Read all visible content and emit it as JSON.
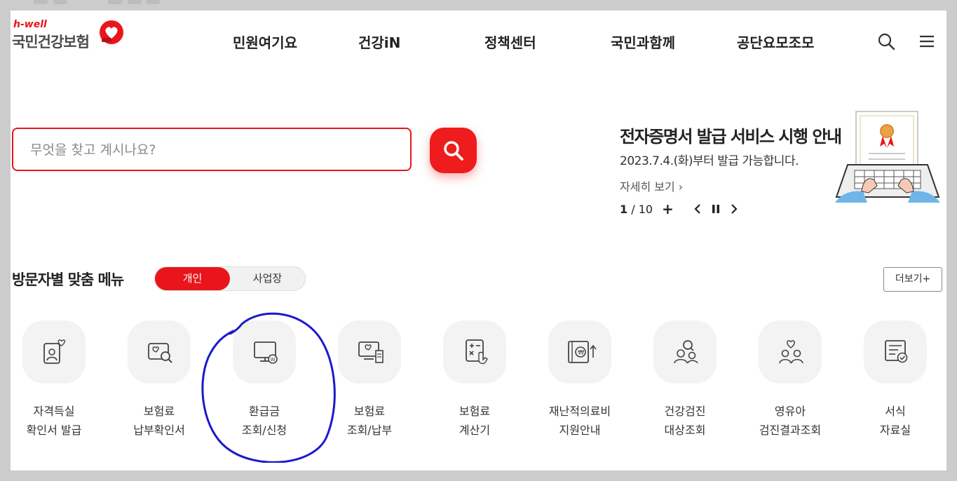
{
  "brand": {
    "tagline": "h-well",
    "name": "국민건강보험"
  },
  "nav": [
    {
      "label": "민원여기요"
    },
    {
      "label": "건강iN"
    },
    {
      "label": "정책센터"
    },
    {
      "label": "국민과함께"
    },
    {
      "label": "공단요모조모"
    }
  ],
  "header_icons": {
    "search": "search-icon",
    "menu": "hamburger-menu-icon"
  },
  "search": {
    "placeholder": "무엇을 찾고 계시나요?",
    "value": ""
  },
  "banner": {
    "title": "전자증명서 발급 서비스 시행 안내",
    "subtitle": "2023.7.4.(화)부터 발급 가능합니다.",
    "more": "자세히 보기 ›",
    "current": "1",
    "separator": "/",
    "total": "10",
    "plus": "+"
  },
  "visitor_menu": {
    "title": "방문자별 맞춤 메뉴",
    "toggle": {
      "personal": "개인",
      "business": "사업장",
      "selected": "개인"
    },
    "more": "더보기+",
    "items": [
      {
        "line1": "자격득실",
        "line2": "확인서 발급",
        "icon": "id-card-heart-icon"
      },
      {
        "line1": "보험료",
        "line2": "납부확인서",
        "icon": "document-search-icon"
      },
      {
        "line1": "환급금",
        "line2": "조회/신청",
        "icon": "monitor-won-icon"
      },
      {
        "line1": "보험료",
        "line2": "조회/납부",
        "icon": "monitor-receipt-icon"
      },
      {
        "line1": "보험료",
        "line2": "계산기",
        "icon": "calculator-icon"
      },
      {
        "line1": "재난적의료비",
        "line2": "지원안내",
        "icon": "won-support-icon"
      },
      {
        "line1": "건강검진",
        "line2": "대상조회",
        "icon": "people-search-icon"
      },
      {
        "line1": "영유아",
        "line2": "검진결과조회",
        "icon": "family-heart-icon"
      },
      {
        "line1": "서식",
        "line2": "자료실",
        "icon": "form-check-icon"
      }
    ]
  },
  "colors": {
    "accent": "#e8161b",
    "annotation": "#1a1acc"
  }
}
